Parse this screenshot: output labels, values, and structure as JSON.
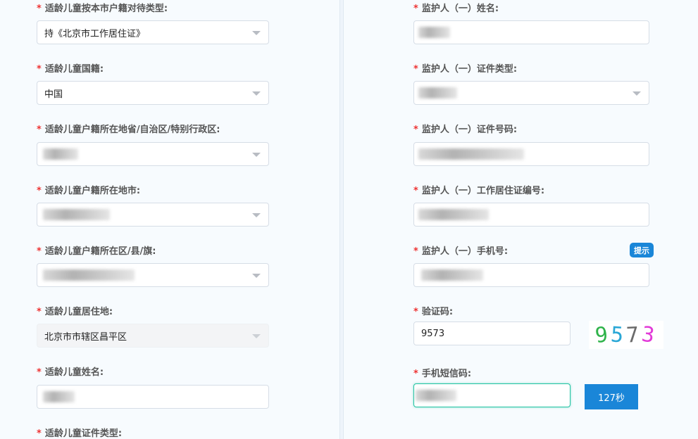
{
  "left": {
    "fields": [
      {
        "label": "适龄儿童按本市户籍对待类型:",
        "value": "持《北京市工作居住证》"
      },
      {
        "label": "适龄儿童国籍:",
        "value": "中国"
      },
      {
        "label": "适龄儿童户籍所在地省/自治区/特别行政区:",
        "value": ""
      },
      {
        "label": "适龄儿童户籍所在地市:",
        "value": ""
      },
      {
        "label": "适龄儿童户籍所在区/县/旗:",
        "value": ""
      },
      {
        "label": "适龄儿童居住地:",
        "value": "北京市市辖区昌平区"
      },
      {
        "label": "适龄儿童姓名:",
        "value": ""
      },
      {
        "label": "适龄儿童证件类型:",
        "value": ""
      }
    ]
  },
  "right": {
    "fields": [
      {
        "label": "监护人（一）姓名:",
        "value": ""
      },
      {
        "label": "监护人（一）证件类型:",
        "value": ""
      },
      {
        "label": "监护人（一）证件号码:",
        "value": ""
      },
      {
        "label": "监护人（一）工作居住证编号:",
        "value": ""
      },
      {
        "label": "监护人（一）手机号:",
        "value": ""
      },
      {
        "label": "验证码:",
        "value": "9573"
      },
      {
        "label": "手机短信码:",
        "value": ""
      }
    ],
    "tip_button": "提示",
    "captcha_digits": [
      {
        "char": "9",
        "color": "#2fb34a"
      },
      {
        "char": "5",
        "color": "#2aa7d6"
      },
      {
        "char": "7",
        "color": "#6b6b6b"
      },
      {
        "char": "3",
        "color": "#e23ad8"
      }
    ],
    "sms_button": "127秒"
  },
  "required_mark": "*"
}
